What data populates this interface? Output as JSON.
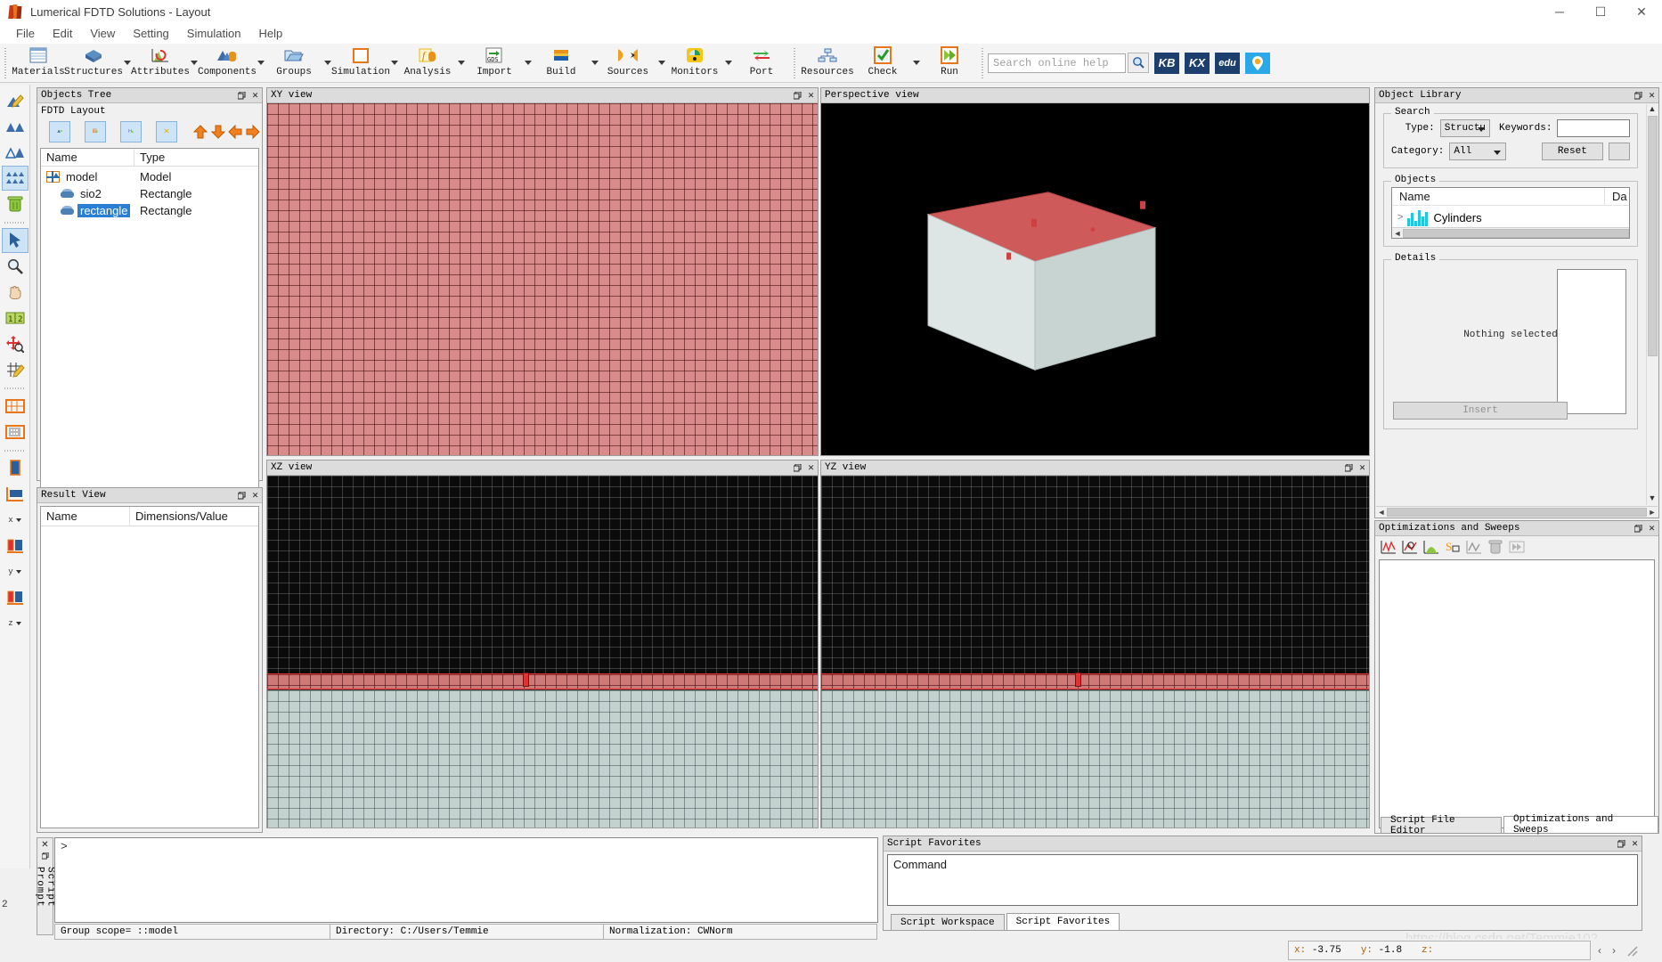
{
  "window": {
    "title": "Lumerical FDTD Solutions - Layout",
    "app_icon": "lumerical-flame-icon",
    "minimize": "─",
    "maximize": "☐",
    "close": "✕"
  },
  "menu": {
    "items": [
      "File",
      "Edit",
      "View",
      "Setting",
      "Simulation",
      "Help"
    ]
  },
  "toolbar": {
    "groups": [
      {
        "buttons": [
          {
            "label": "Materials",
            "icon": "materials-icon",
            "caret": false
          },
          {
            "label": "Structures",
            "icon": "structures-icon",
            "caret": true
          },
          {
            "label": "Attributes",
            "icon": "attributes-icon",
            "caret": true
          },
          {
            "label": "Components",
            "icon": "components-icon",
            "caret": true
          },
          {
            "label": "Groups",
            "icon": "groups-icon",
            "caret": true
          },
          {
            "label": "Simulation",
            "icon": "simulation-icon",
            "caret": true
          },
          {
            "label": "Analysis",
            "icon": "analysis-icon",
            "caret": true
          },
          {
            "label": "Import",
            "icon": "import-gds-icon",
            "caret": true
          },
          {
            "label": "Build",
            "icon": "build-icon",
            "caret": true
          },
          {
            "label": "Sources",
            "icon": "sources-icon",
            "caret": true
          },
          {
            "label": "Monitors",
            "icon": "monitors-icon",
            "caret": true
          },
          {
            "label": "Port",
            "icon": "port-icon",
            "caret": false
          }
        ]
      },
      {
        "buttons": [
          {
            "label": "Resources",
            "icon": "resources-icon",
            "caret": false
          },
          {
            "label": "Check",
            "icon": "check-icon",
            "caret": true
          },
          {
            "label": "Run",
            "icon": "run-icon",
            "caret": false
          }
        ]
      }
    ],
    "search": {
      "placeholder": "Search online help",
      "value": "",
      "icon": "search-icon"
    },
    "brand_buttons": [
      {
        "label": "KB",
        "color": "#1c3f6e"
      },
      {
        "label": "KX",
        "color": "#1c3f6e"
      },
      {
        "label": "edu",
        "color": "#1c3f6e"
      },
      {
        "label": "●",
        "color": "#2aa8e8"
      }
    ]
  },
  "left_toolbar": {
    "items": [
      {
        "icon": "edit-object-icon",
        "selected": false
      },
      {
        "icon": "two-objects-icon",
        "selected": false
      },
      {
        "icon": "outline-object-icon",
        "selected": false
      },
      {
        "icon": "select-all-objects-icon",
        "selected": true
      },
      {
        "icon": "delete-trash-icon",
        "selected": false
      },
      {
        "icon": "pointer-select-icon",
        "selected": true
      },
      {
        "icon": "zoom-magnifier-icon",
        "selected": false
      },
      {
        "icon": "pan-hand-icon",
        "selected": false
      },
      {
        "icon": "measure-ruler-icon",
        "selected": false
      },
      {
        "icon": "move-resize-icon",
        "selected": false
      },
      {
        "icon": "edit-grid-icon",
        "selected": false
      },
      {
        "icon": "mesh-grid-icon",
        "selected": false
      },
      {
        "icon": "mesh-calc-icon",
        "selected": false
      },
      {
        "icon": "view-perspective-icon",
        "selected": false
      },
      {
        "icon": "view-xy-icon",
        "selected": false
      },
      {
        "icon": "view-x-icon",
        "selected": false,
        "axis": "x"
      },
      {
        "icon": "view-y-icon",
        "selected": false,
        "axis": "y"
      },
      {
        "icon": "view-z-icon",
        "selected": false,
        "axis": "z"
      }
    ]
  },
  "objects_tree": {
    "title": "Objects Tree",
    "subtitle": "FDTD Layout",
    "toolbar_icons": [
      "add-object-icon",
      "add-mesh-icon",
      "add-dimension-icon",
      "group-objects-icon",
      "move-up-icon",
      "move-down-icon",
      "move-left-icon",
      "move-right-icon"
    ],
    "columns": [
      "Name",
      "Type"
    ],
    "rows": [
      {
        "name": "model",
        "type": "Model",
        "indent": 0,
        "icon": "model-icon",
        "selected": false
      },
      {
        "name": "sio2",
        "type": "Rectangle",
        "indent": 1,
        "icon": "rectangle-icon",
        "selected": false
      },
      {
        "name": "rectangle",
        "type": "Rectangle",
        "indent": 1,
        "icon": "rectangle-icon",
        "selected": true
      }
    ],
    "dock_icon": "restore-icon",
    "close_icon": "close-icon"
  },
  "result_view": {
    "title": "Result View",
    "columns": [
      "Name",
      "Dimensions/Value"
    ],
    "rows": []
  },
  "viewports": [
    {
      "id": "xy",
      "title": "XY view"
    },
    {
      "id": "perspective",
      "title": "Perspective view"
    },
    {
      "id": "xz",
      "title": "XZ view"
    },
    {
      "id": "yz",
      "title": "YZ view"
    }
  ],
  "object_library": {
    "title": "Object Library",
    "search_group": "Search",
    "type_label": "Type:",
    "type_value": "Structu",
    "category_label": "Category:",
    "category_value": "All",
    "keywords_label": "Keywords:",
    "keywords_value": "",
    "reset_label": "Reset",
    "objects_group": "Objects",
    "objects_columns": [
      "Name",
      "Da"
    ],
    "objects_rows": [
      {
        "name": "Cylinders",
        "icon": "cylinders-icon",
        "expander": ">"
      }
    ],
    "details_group": "Details",
    "details_empty": "Nothing selected",
    "insert_label": "Insert"
  },
  "optimizations": {
    "title": "Optimizations and Sweeps",
    "toolbar_icons": [
      "add-sweep-icon",
      "add-optimization-icon",
      "add-mc-analysis-icon",
      "edit-sweep-icon",
      "view-plot-icon",
      "delete-trash-icon",
      "run-sweep-icon"
    ],
    "items": [],
    "tabs": [
      {
        "label": "Script File Editor",
        "active": false
      },
      {
        "label": "Optimizations and Sweeps",
        "active": true
      }
    ]
  },
  "script_prompt": {
    "vertical_label": "Script Prompt",
    "prompt_char": ">",
    "close_icon": "close-icon",
    "dock_icon": "restore-icon",
    "left_margin_number": "2"
  },
  "script_favorites": {
    "title": "Script Favorites",
    "content_label": "Command",
    "tabs": [
      {
        "label": "Script Workspace",
        "active": false
      },
      {
        "label": "Script Favorites",
        "active": true
      }
    ],
    "dock_icon": "restore-icon",
    "close_icon": "close-icon"
  },
  "status_bar": {
    "cells": [
      "Group scope= ::model",
      "Directory: C:/Users/Temmie",
      "Normalization: CWNorm"
    ]
  },
  "coordinates": {
    "x_label": "x:",
    "x_value": "-3.75",
    "y_label": "y:",
    "y_value": "-1.8",
    "z_label": "z:",
    "z_value": "",
    "prev_icon": "‹",
    "next_icon": "›",
    "resize_icon": "resize-grip-icon"
  },
  "watermark": "https://blog.csdn.net/Temmie102",
  "colors": {
    "accent_orange": "#e8761a",
    "selection_blue": "#2a7fd4",
    "structure_red": "#cf6a6a",
    "structure_grey": "#c3d1cf",
    "panel_bg": "#f0f0f0"
  }
}
